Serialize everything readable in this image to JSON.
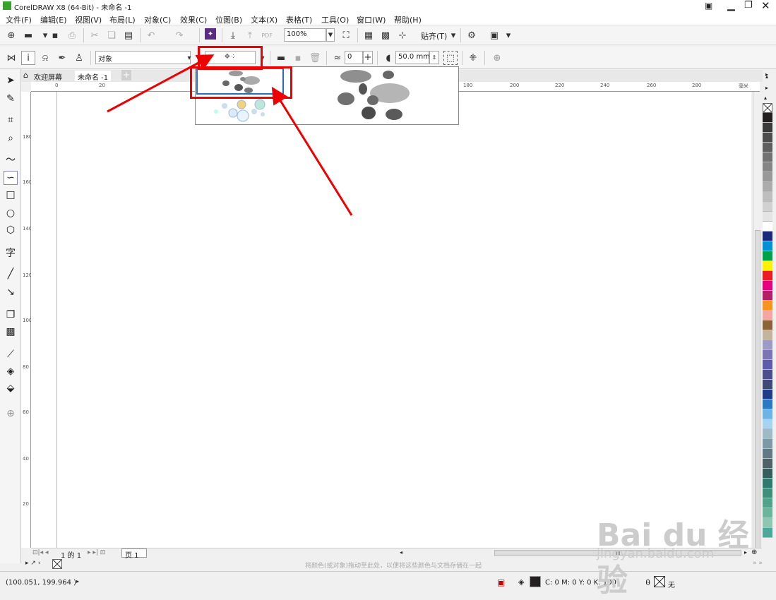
{
  "window": {
    "title": "CorelDRAW X8 (64-Bit) - 未命名 -1"
  },
  "menu": [
    "文件(F)",
    "编辑(E)",
    "视图(V)",
    "布局(L)",
    "对象(C)",
    "效果(C)",
    "位图(B)",
    "文本(X)",
    "表格(T)",
    "工具(O)",
    "窗口(W)",
    "帮助(H)"
  ],
  "toolbar": {
    "zoom": "100%",
    "snap_label": "贴齐(T)"
  },
  "property_bar": {
    "object_select": "对象",
    "spacing_value": "0",
    "size_value": "50.0 mm"
  },
  "tabs": {
    "welcome": "欢迎屏幕",
    "document": "未命名 -1"
  },
  "ruler": {
    "h_ticks": [
      "20",
      "0",
      "20",
      "180",
      "200",
      "220",
      "240",
      "260",
      "280",
      "毫米"
    ],
    "v_ticks": [
      "180",
      "160",
      "140",
      "120",
      "100",
      "80",
      "60",
      "40",
      "20"
    ]
  },
  "pagebar": {
    "pages": "1 的 1",
    "page_tab": "页 1"
  },
  "hint": "将颜色(或对象)拖动至此处，以便将这些颜色与文档存储在一起",
  "status": {
    "coords": "(100.051, 199.964 )",
    "fill": "C: 0 M: 0 Y: 0 K: 100",
    "outline": "无"
  },
  "watermark": {
    "main": "Bai du 经验",
    "sub": "jingyan.baidu.com"
  },
  "palette_colors": [
    "#231f20",
    "#3a3a3a",
    "#4d4d4d",
    "#5f5f5f",
    "#727272",
    "#858585",
    "#989898",
    "#ababab",
    "#bebebe",
    "#d1d1d1",
    "#e4e4e4",
    "#ffffff",
    "#1b2a7a",
    "#0091d5",
    "#00a14b",
    "#fff200",
    "#ed1c24",
    "#e6007e",
    "#b51f65",
    "#f7941d",
    "#f4a6a3",
    "#8c6239",
    "#c2b59b",
    "#9e9ac8",
    "#7d74b5",
    "#5f5ba6",
    "#4b4f8c",
    "#3f4a75",
    "#1f3c88",
    "#2b79c2",
    "#6ab4e6",
    "#a6d3ef",
    "#9fb9c6",
    "#7f98a6",
    "#637a86",
    "#4f6169",
    "#375e5f",
    "#2e7a6f",
    "#3f8f7b",
    "#52a38c",
    "#6db49c",
    "#8ec7b1",
    "#4ea89a"
  ]
}
